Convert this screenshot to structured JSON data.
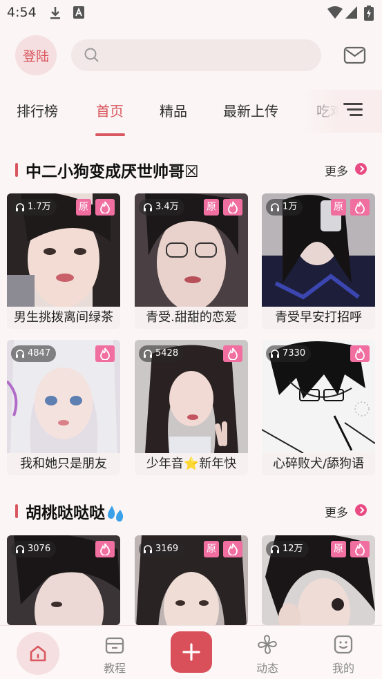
{
  "status_bar": {
    "time": "4:54",
    "icons": [
      "download-icon",
      "font-a-icon",
      "wifi-icon",
      "signal-icon",
      "battery-icon"
    ]
  },
  "header": {
    "login_label": "登陆",
    "search_placeholder": "",
    "icons": [
      "search-icon",
      "mail-icon"
    ]
  },
  "tabs": [
    {
      "label": "排行榜",
      "active": false
    },
    {
      "label": "首页",
      "active": true
    },
    {
      "label": "精品",
      "active": false
    },
    {
      "label": "最新上传",
      "active": false
    },
    {
      "label": "吃鸡",
      "active": false
    }
  ],
  "sections": [
    {
      "title": "中二小狗变成厌世帅哥☒",
      "more_label": "更多",
      "cards": [
        {
          "plays": "1.7万",
          "original": "原",
          "hot": true,
          "caption": "男生挑拨离间绿茶"
        },
        {
          "plays": "3.4万",
          "original": "原",
          "hot": true,
          "caption": "青受.甜甜的恋爱"
        },
        {
          "plays": "1万",
          "original": "原",
          "hot": true,
          "caption": "青受早安打招呼"
        },
        {
          "plays": "4847",
          "original": "",
          "hot": true,
          "caption": "我和她只是朋友"
        },
        {
          "plays": "5428",
          "original": "",
          "hot": true,
          "caption": "少年音⭐新年快"
        },
        {
          "plays": "7330",
          "original": "",
          "hot": true,
          "caption": "心碎败犬/舔狗语"
        }
      ]
    },
    {
      "title": "胡桃哒哒哒",
      "more_label": "更多",
      "cards": [
        {
          "plays": "3076",
          "original": "",
          "hot": true,
          "caption": ""
        },
        {
          "plays": "3169",
          "original": "原",
          "hot": true,
          "caption": ""
        },
        {
          "plays": "12万",
          "original": "原",
          "hot": true,
          "caption": ""
        }
      ]
    }
  ],
  "bottom_nav": [
    {
      "label": "",
      "icon": "home-icon",
      "active": true
    },
    {
      "label": "教程",
      "icon": "box-icon"
    },
    {
      "label": "",
      "icon": "plus-icon"
    },
    {
      "label": "动态",
      "icon": "pinwheel-icon"
    },
    {
      "label": "我的",
      "icon": "smile-icon"
    }
  ],
  "colors": {
    "accent": "#d9575f",
    "badge_pink": "#f06fa0",
    "more_dot": "#e94b83",
    "background": "#fbf5f5"
  }
}
